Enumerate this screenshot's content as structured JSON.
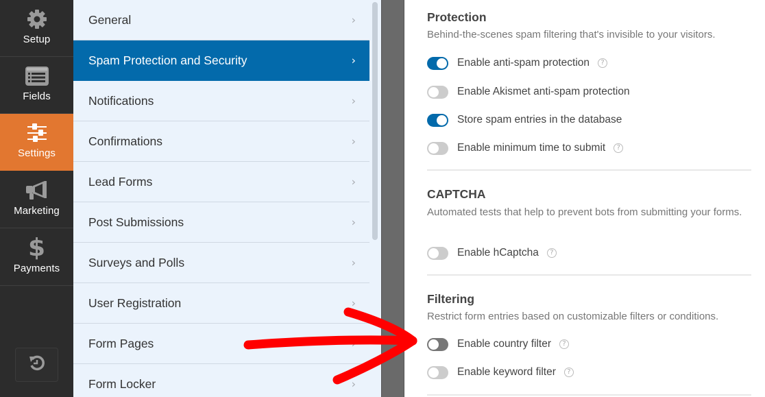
{
  "sidebar": {
    "items": [
      {
        "label": "Setup",
        "icon": "gear-icon",
        "active": false
      },
      {
        "label": "Fields",
        "icon": "fields-list-icon",
        "active": false
      },
      {
        "label": "Settings",
        "icon": "sliders-icon",
        "active": true
      },
      {
        "label": "Marketing",
        "icon": "megaphone-icon",
        "active": false
      },
      {
        "label": "Payments",
        "icon": "dollar-icon",
        "active": false
      }
    ],
    "revisions_icon": "history-undo-icon"
  },
  "menu": {
    "items": [
      {
        "label": "General",
        "active": false
      },
      {
        "label": "Spam Protection and Security",
        "active": true
      },
      {
        "label": "Notifications",
        "active": false
      },
      {
        "label": "Confirmations",
        "active": false
      },
      {
        "label": "Lead Forms",
        "active": false
      },
      {
        "label": "Post Submissions",
        "active": false
      },
      {
        "label": "Surveys and Polls",
        "active": false
      },
      {
        "label": "User Registration",
        "active": false
      },
      {
        "label": "Form Pages",
        "active": false
      },
      {
        "label": "Form Locker",
        "active": false
      }
    ],
    "chevron": "›"
  },
  "panel": {
    "sections": [
      {
        "title": "Protection",
        "description": "Behind-the-scenes spam filtering that's invisible to your visitors.",
        "options": [
          {
            "label": "Enable anti-spam protection",
            "enabled": true,
            "help": true
          },
          {
            "label": "Enable Akismet anti-spam protection",
            "enabled": false,
            "help": false
          },
          {
            "label": "Store spam entries in the database",
            "enabled": true,
            "help": false
          },
          {
            "label": "Enable minimum time to submit",
            "enabled": false,
            "help": true
          }
        ]
      },
      {
        "title": "CAPTCHA",
        "description": "Automated tests that help to prevent bots from submitting your forms.",
        "options": [
          {
            "label": "Enable hCaptcha",
            "enabled": false,
            "help": true
          }
        ]
      },
      {
        "title": "Filtering",
        "description": "Restrict form entries based on customizable filters or conditions.",
        "options": [
          {
            "label": "Enable country filter",
            "enabled": false,
            "help": true,
            "hovered": true
          },
          {
            "label": "Enable keyword filter",
            "enabled": false,
            "help": true
          }
        ]
      }
    ],
    "help_glyph": "?"
  },
  "colors": {
    "sidebar_bg": "#2c2c2c",
    "sidebar_active": "#e27730",
    "menu_bg": "#ebf3fc",
    "menu_active": "#036aab",
    "toggle_on": "#036aab",
    "toggle_off": "#cccccc",
    "annotation_arrow": "#ff0000"
  }
}
